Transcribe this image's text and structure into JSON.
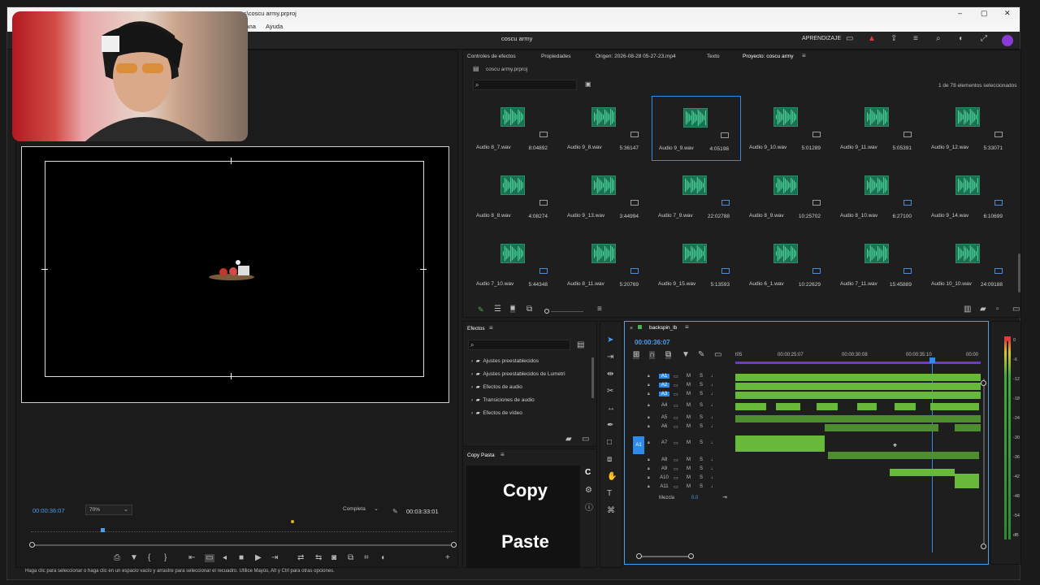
{
  "window": {
    "title": "vos\\coscu army.prproj",
    "controls": [
      "–",
      "▢",
      "✕"
    ]
  },
  "menu": {
    "items": [
      "entana",
      "Ayuda"
    ]
  },
  "header": {
    "project_title": "coscu army",
    "learning_label": "APRENDIZAJE"
  },
  "program_monitor": {
    "timecode": "00:00:36:07",
    "zoom": "70%",
    "quality": "Completa",
    "duration": "00:03:33:01"
  },
  "source_panel": {
    "tabs": [
      "Controles de efectos",
      "Propiedades",
      "Origen: 2026-08-28 05-27-23.mp4",
      "Texto",
      "Proyecto: coscu army"
    ],
    "active_tab_index": 4
  },
  "project": {
    "file": "coscu army.prproj",
    "search_placeholder": "",
    "selection_info": "1 de 78 elementos seleccionados",
    "items": [
      {
        "name": "Audio 8_7.wav",
        "duration": "8:04892",
        "badge": "gray"
      },
      {
        "name": "Audio 9_8.wav",
        "duration": "5:36147",
        "badge": "gray"
      },
      {
        "name": "Audio 9_9.wav",
        "duration": "4:05198",
        "badge": "gray",
        "selected": true
      },
      {
        "name": "Audio 9_10.wav",
        "duration": "5:01289",
        "badge": "gray"
      },
      {
        "name": "Audio 9_11.wav",
        "duration": "5:05391",
        "badge": "gray"
      },
      {
        "name": "Audio 9_12.wav",
        "duration": "5:33071",
        "badge": "gray"
      },
      {
        "name": "Audio 8_8.wav",
        "duration": "4:08274",
        "badge": "gray"
      },
      {
        "name": "Audio 9_13.wav",
        "duration": "3:44994",
        "badge": "gray"
      },
      {
        "name": "Audio 7_9.wav",
        "duration": "22:02788",
        "badge": "blue"
      },
      {
        "name": "Audio 8_9.wav",
        "duration": "10:25702",
        "badge": "gray"
      },
      {
        "name": "Audio 8_10.wav",
        "duration": "6:27100",
        "badge": "blue"
      },
      {
        "name": "Audio 9_14.wav",
        "duration": "6:10699",
        "badge": "blue"
      },
      {
        "name": "Audio 7_10.wav",
        "duration": "5:44348",
        "badge": "blue"
      },
      {
        "name": "Audio 8_11.wav",
        "duration": "5:20769",
        "badge": "blue"
      },
      {
        "name": "Audio 9_15.wav",
        "duration": "5:13593",
        "badge": "blue"
      },
      {
        "name": "Audio 6_1.wav",
        "duration": "10:22629",
        "badge": "blue"
      },
      {
        "name": "Audio 7_11.wav",
        "duration": "15:45889",
        "badge": "blue"
      },
      {
        "name": "Audio 10_10.wav",
        "duration": "24:09188",
        "badge": "blue"
      }
    ]
  },
  "effects": {
    "title": "Efectos",
    "search_placeholder": "",
    "folders": [
      "Ajustes preestablecidos",
      "Ajustes preestablecidos de Lumetri",
      "Efectos de audio",
      "Transiciones de audio",
      "Efectos de vídeo"
    ]
  },
  "copy_paste": {
    "title": "Copy Pasta",
    "copy_label": "Copy",
    "paste_label": "Paste"
  },
  "timeline": {
    "sequence_name": "backspin_lb",
    "timecode": "00:00:36:07",
    "ruler": [
      "t05",
      "00:00:25:07",
      "00:00:30:08",
      "00:00:35:10",
      "00:00"
    ],
    "tracks": [
      "A1",
      "A2",
      "A3",
      "A4",
      "A5",
      "A6",
      "A7",
      "A8",
      "A9",
      "A10",
      "A11"
    ],
    "mix_label": "Mezcla",
    "mix_value": "0.0",
    "source_patch": "A1"
  },
  "audio_meter": {
    "labels": [
      "0",
      "-6",
      "-12",
      "-18",
      "-24",
      "-30",
      "-36",
      "-42",
      "-48",
      "-54",
      "dB"
    ]
  },
  "status_bar": {
    "text": "Haga clic para seleccionar o haga clic en un espacio vacío y arrastre para seleccionar el recuadro. Utilice Mayús, Alt y Ctrl para otras opciones."
  },
  "colors": {
    "accent_blue": "#2d8ceb",
    "clip_green": "#68b93a",
    "wave_green": "#1d6f52",
    "alert_red": "#e03a3a",
    "sequence_purple": "#6d3cc9"
  }
}
